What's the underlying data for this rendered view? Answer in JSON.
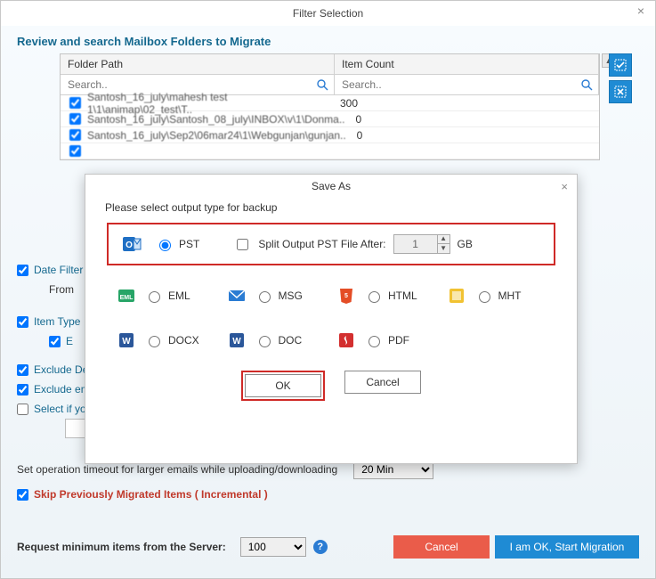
{
  "window": {
    "title": "Filter Selection"
  },
  "review_label": "Review and search Mailbox Folders to Migrate",
  "grid": {
    "headers": {
      "path": "Folder Path",
      "count": "Item Count"
    },
    "search_placeholder": "Search..",
    "rows": [
      {
        "path": "Santosh_16_july\\mahesh test 1\\1\\animap\\02_test\\T..",
        "count": "300"
      },
      {
        "path": "Santosh_16_july\\Santosh_08_july\\INBOX\\v\\1\\Donma..",
        "count": "0"
      },
      {
        "path": "Santosh_16_july\\Sep2\\06mar24\\1\\Webgunjan\\gunjan..",
        "count": "0"
      },
      {
        "path": "",
        "count": ""
      }
    ]
  },
  "checks": {
    "date_filter": "Date Filter",
    "from_label": "From",
    "item_type": "Item Type",
    "item_e": "E",
    "exclude_d": "Exclude De",
    "exclude_em": "Exclude em",
    "select_if": "Select if yo"
  },
  "timeout": {
    "label": "Set operation timeout for larger emails while uploading/downloading",
    "value": "20 Min"
  },
  "skip_label": "Skip Previously Migrated Items ( Incremental )",
  "request": {
    "label": "Request minimum items from the Server:",
    "value": "100"
  },
  "buttons": {
    "cancel": "Cancel",
    "start": "I am OK, Start Migration"
  },
  "saveas": {
    "title": "Save As",
    "subtitle": "Please select output type for backup",
    "pst": "PST",
    "split_label": "Split Output PST File After:",
    "split_value": "1",
    "split_unit": "GB",
    "formats": {
      "eml": "EML",
      "msg": "MSG",
      "html": "HTML",
      "mht": "MHT",
      "docx": "DOCX",
      "doc": "DOC",
      "pdf": "PDF"
    },
    "ok": "OK",
    "cancel": "Cancel"
  }
}
